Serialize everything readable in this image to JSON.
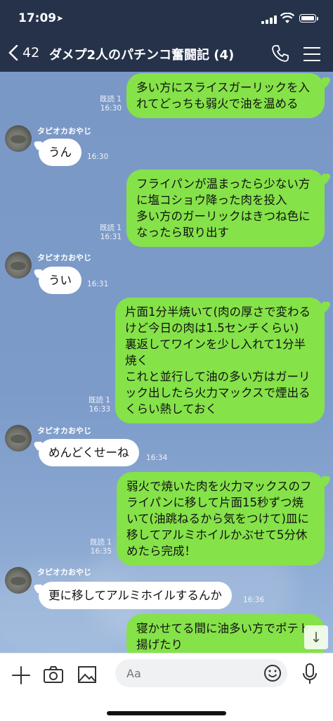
{
  "status_bar": {
    "time": "17:09"
  },
  "header": {
    "back_count": "42",
    "title": "ダメプ2人のパチンコ奮闘記 (4)"
  },
  "messages": [
    {
      "type": "out",
      "text": "多い方にスライスガーリックを入れてどっちも弱火で油を温める",
      "read": "既読 1",
      "time": "16:30"
    },
    {
      "type": "in",
      "sender": "タピオカおやじ",
      "text": "うん",
      "time": "16:30"
    },
    {
      "type": "out",
      "text": "フライパンが温まったら少ない方に塩コショウ降った肉を投入\n多い方のガーリックはきつね色になったら取り出す",
      "read": "既読 1",
      "time": "16:31"
    },
    {
      "type": "in",
      "sender": "タピオカおやじ",
      "text": "うい",
      "time": "16:31"
    },
    {
      "type": "out",
      "text": "片面1分半焼いて(肉の厚さで変わるけど今日の肉は1.5センチくらい)\n裏返してワインを少し入れて1分半焼く\nこれと並行して油の多い方はガーリック出したら火力マックスで煙出るくらい熱しておく",
      "read": "既読 1",
      "time": "16:33"
    },
    {
      "type": "in",
      "sender": "タピオカおやじ",
      "text": "めんどくせーね",
      "time": "16:34"
    },
    {
      "type": "out",
      "text": "弱火で焼いた肉を火力マックスのフライパンに移して片面15秒ずつ焼いて(油跳ねるから気をつけて)皿に移してアルミホイルかぶせて5分休めたら完成！",
      "read": "既読 1",
      "time": "16:35"
    },
    {
      "type": "in",
      "sender": "タピオカおやじ",
      "text": "更に移してアルミホイルするんか",
      "time": "16:36"
    },
    {
      "type": "out",
      "text": "寝かせてる間に油多い方でポテト揚げたり",
      "read": "",
      "time": ""
    }
  ],
  "input": {
    "placeholder": "Aa"
  },
  "colors": {
    "header_bg": "#25324a",
    "chat_bg": "#7b9ac8",
    "out_bubble": "#85e249",
    "in_bubble": "#ffffff"
  },
  "icons": [
    "location-arrow-icon",
    "signal-icon",
    "wifi-icon",
    "battery-icon",
    "back-chevron-icon",
    "phone-icon",
    "menu-icon",
    "plus-icon",
    "camera-icon",
    "image-icon",
    "emoji-icon",
    "mic-icon",
    "arrow-down-icon"
  ]
}
